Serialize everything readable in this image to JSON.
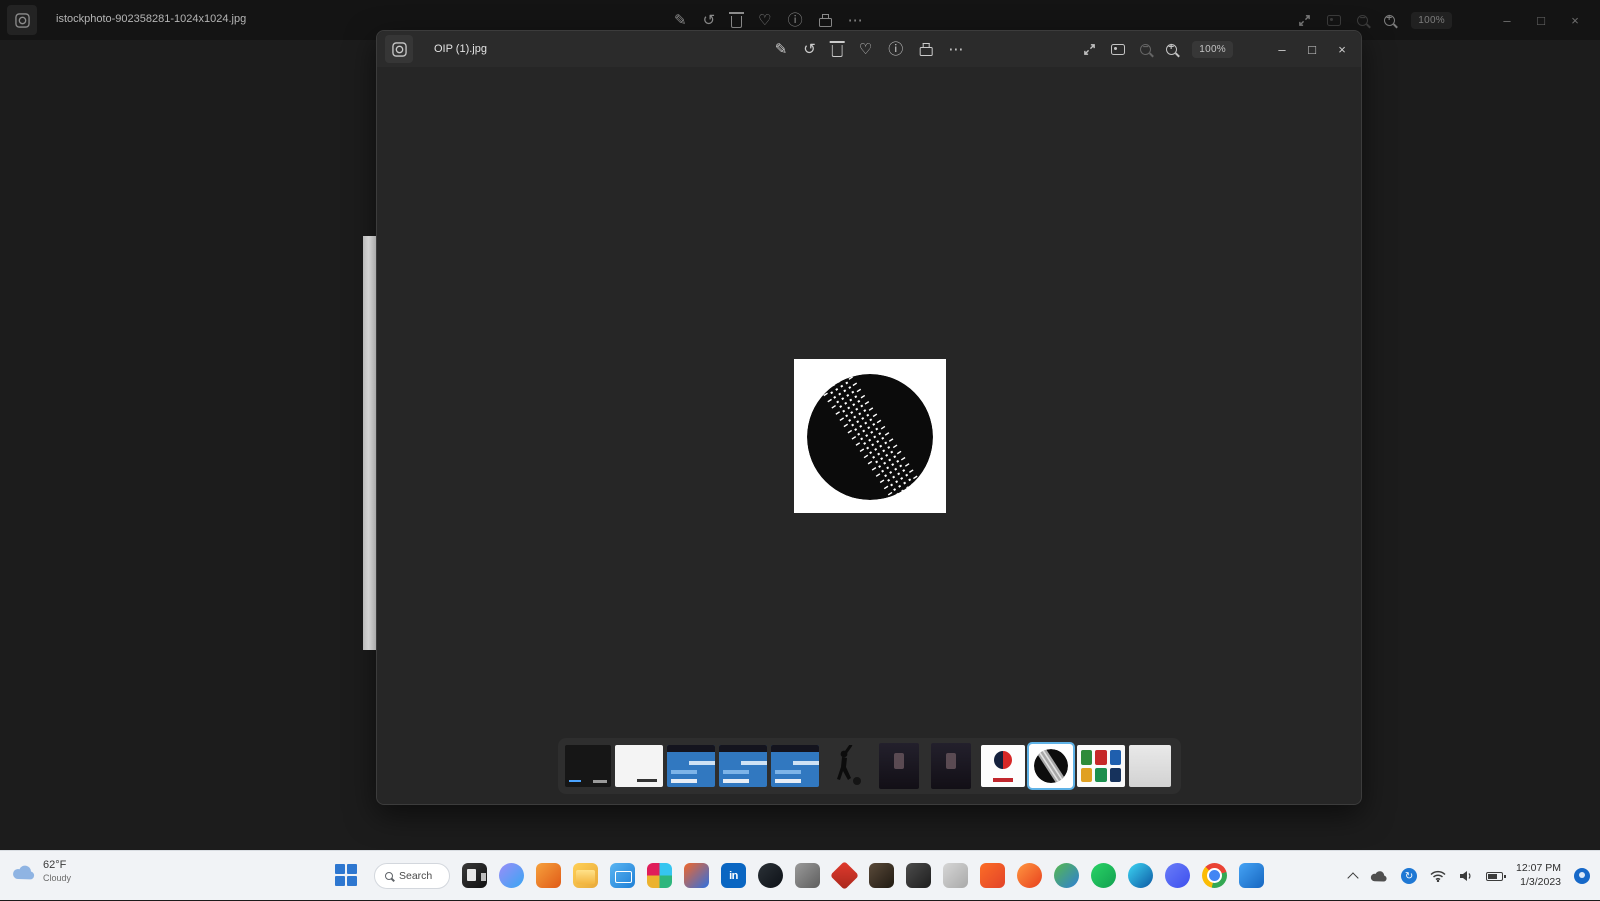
{
  "colors": {
    "desktop_bg": "#1c1c1c",
    "window_bg": "#262626",
    "filmstrip_bg": "#2e2e2e",
    "selection_border": "#5fb2e6",
    "taskbar_bg": "#f1f3f6",
    "accent_blue": "#1f78d4"
  },
  "background_app": {
    "title": "istockphoto-902358281-1024x1024.jpg",
    "zoom_level": "100%",
    "toolbar": {
      "edit": "✎",
      "rotate": "↺",
      "favorite": "♡",
      "info": "ⓘ",
      "more": "⋯"
    },
    "window_controls": {
      "minimize": "–",
      "maximize": "□",
      "close": "×"
    },
    "toolbar_icon_names": [
      "edit-image",
      "rotate",
      "delete",
      "favorite",
      "info",
      "print",
      "more",
      "fullscreen",
      "gallery-view",
      "zoom-out",
      "zoom-in"
    ]
  },
  "viewer": {
    "title": "OIP (1).jpg",
    "zoom_level": "100%",
    "toolbar": {
      "edit": "✎",
      "rotate": "↺",
      "favorite": "♡",
      "info": "ⓘ",
      "more": "⋯"
    },
    "window_controls": {
      "minimize": "–",
      "maximize": "□",
      "close": "×"
    },
    "image_alt": "black and white cricket ball illustration on white background",
    "filmstrip_items": [
      "dark-video-frame",
      "white-slide",
      "blue-webpage-1",
      "blue-webpage-2",
      "blue-webpage-3",
      "cricket-batsman-silhouette",
      "dark-poster-1",
      "dark-poster-2",
      "cricket-club-logo",
      "cricket-ball (selected)",
      "logo-collection-sheet",
      "light-document"
    ],
    "selected_thumbnail_index": 9
  },
  "taskbar": {
    "weather_temp": "62°F",
    "weather_condition": "Cloudy",
    "search_label": "Search",
    "apps": [
      {
        "name": "task-view",
        "c1": "#3a3a3a",
        "c2": "#101010"
      },
      {
        "name": "copilot",
        "c1": "#9a8df8",
        "c2": "#38a6f3"
      },
      {
        "name": "pen",
        "c1": "#f6a13d",
        "c2": "#e05a17"
      },
      {
        "name": "file-explorer",
        "c1": "#ffd056",
        "c2": "#e8a93a"
      },
      {
        "name": "mail",
        "c1": "#5ab5f2",
        "c2": "#1f7fd6"
      },
      {
        "name": "slack",
        "c1": "#36c5f0",
        "c2": "#2eb67d",
        "c3": "#ecb22e",
        "c4": "#e01e5a"
      },
      {
        "name": "paint",
        "c1": "#f2672a",
        "c2": "#2f6fe0"
      },
      {
        "name": "linkedin",
        "c1": "#0a66c2",
        "c2": "#0a66c2",
        "label": "in"
      },
      {
        "name": "github",
        "c1": "#2b3137",
        "c2": "#0d1117"
      },
      {
        "name": "remote-app",
        "c1": "#9a9a9a",
        "c2": "#5e5e5e"
      },
      {
        "name": "dev-diamond",
        "c1": "#e23b2e",
        "c2": "#a8271c"
      },
      {
        "name": "orange-tool",
        "c1": "#5a4a3a",
        "c2": "#201a12"
      },
      {
        "name": "media-tool",
        "c1": "#4c4c4c",
        "c2": "#1e1e1e"
      },
      {
        "name": "settings",
        "c1": "#d6d6d6",
        "c2": "#a9a9a9"
      },
      {
        "name": "gitlab",
        "c1": "#fc6d26",
        "c2": "#e24329"
      },
      {
        "name": "firefox",
        "c1": "#ff9640",
        "c2": "#e8401d"
      },
      {
        "name": "chromium",
        "c1": "#57b84e",
        "c2": "#2f7fd4"
      },
      {
        "name": "whatsapp",
        "c1": "#2ad366",
        "c2": "#12a050"
      },
      {
        "name": "edge",
        "c1": "#3dd5f3",
        "c2": "#0c59a4"
      },
      {
        "name": "discord",
        "c1": "#6a7df8",
        "c2": "#3d4fee"
      },
      {
        "name": "chrome",
        "c1": "#ea4335",
        "c2": "#34a853",
        "c3": "#fbbc05",
        "c4": "#4285f4"
      },
      {
        "name": "vscode",
        "c1": "#45a3f5",
        "c2": "#1666c0"
      }
    ],
    "tray": {
      "time": "12:07 PM",
      "date": "1/3/2023"
    }
  }
}
